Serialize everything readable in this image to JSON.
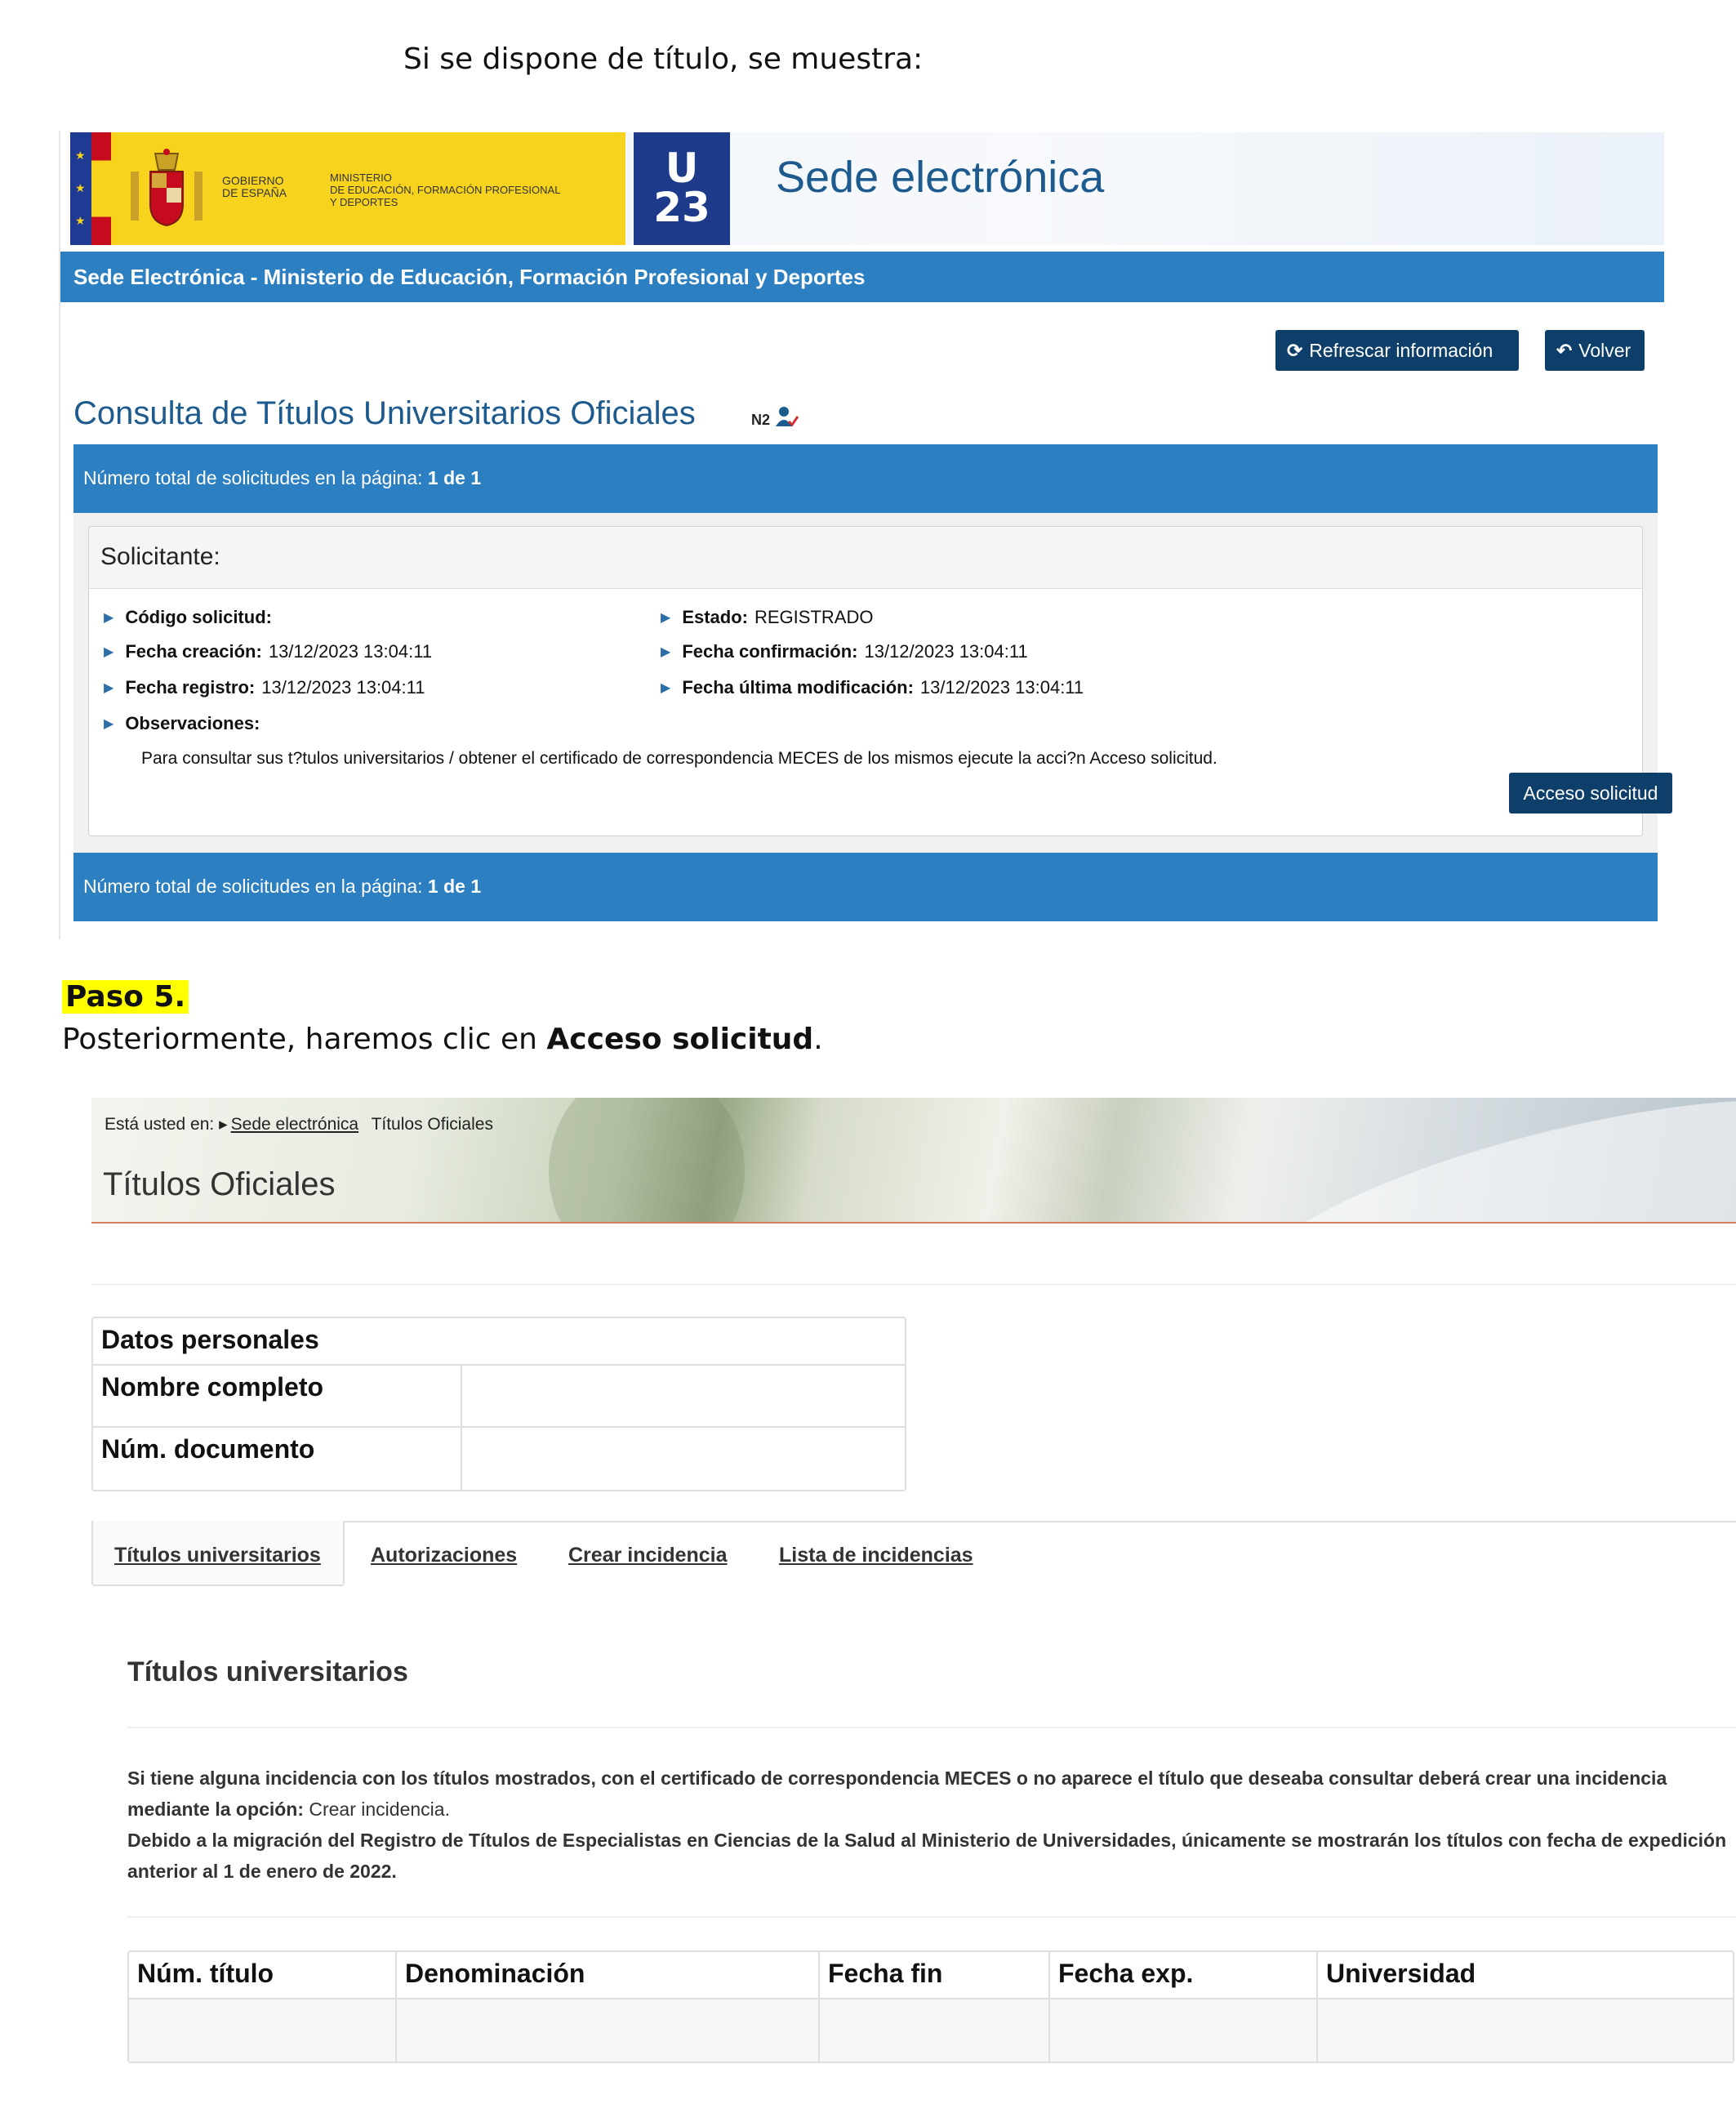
{
  "doc": {
    "intro": "Si se dispone de título, se muestra:",
    "step_label": "Paso 5.",
    "step_text_before": "Posteriormente, haremos clic en ",
    "step_text_bold": "Acceso solicitud",
    "step_text_after": "."
  },
  "sede": {
    "gob_line1": "GOBIERNO",
    "gob_line2": "DE ESPAÑA",
    "min_line1": "MINISTERIO",
    "min_line2": "DE EDUCACIÓN, FORMACIÓN PROFESIONAL",
    "min_line3": "Y DEPORTES",
    "u23_top": "U",
    "u23_bottom": "23",
    "site_title": "Sede electrónica",
    "bar_title": "Sede Electrónica - Ministerio de Educación, Formación Profesional y Deportes",
    "refresh_label": "Refrescar información",
    "volver_label": "Volver",
    "page_title": "Consulta de Títulos Universitarios Oficiales",
    "badge": "N2",
    "count_label": "Número total de solicitudes en la página:",
    "count_value": "1 de 1",
    "panel_title": "Solicitante:",
    "fields": {
      "codigo_label": "Código solicitud:",
      "codigo_value": "",
      "estado_label": "Estado:",
      "estado_value": "REGISTRADO",
      "creacion_label": "Fecha creación:",
      "creacion_value": "13/12/2023 13:04:11",
      "confirmacion_label": "Fecha confirmación:",
      "confirmacion_value": "13/12/2023 13:04:11",
      "registro_label": "Fecha registro:",
      "registro_value": "13/12/2023 13:04:11",
      "modificacion_label": "Fecha última modificación:",
      "modificacion_value": "13/12/2023 13:04:11",
      "observaciones_label": "Observaciones:",
      "observaciones_value": "Para consultar sus t?tulos universitarios / obtener el certificado de correspondencia MECES de los mismos ejecute la acci?n Acceso solicitud."
    },
    "acceso_label": "Acceso solicitud"
  },
  "titulos": {
    "crumb_prefix": "Está usted en:",
    "crumb_link": "Sede electrónica",
    "crumb_current": "Títulos Oficiales",
    "heading": "Títulos Oficiales",
    "personal_header": "Datos personales",
    "nombre_label": "Nombre completo",
    "nombre_value": "",
    "documento_label": "Núm. documento",
    "documento_value": "",
    "tabs": [
      "Títulos universitarios",
      "Autorizaciones",
      "Crear incidencia",
      "Lista de incidencias"
    ],
    "section_heading": "Títulos universitarios",
    "info_line1a": "Si tiene alguna incidencia con los títulos mostrados, con el certificado de correspondencia MECES o no aparece el título que deseaba consultar deberá crear una incidencia mediante la opción:",
    "info_line1b": " Crear incidencia.",
    "info_line2": "Debido a la migración del Registro de Títulos de Especialistas en Ciencias de la Salud al Ministerio de Universidades, únicamente se mostrarán los títulos con fecha de expedición anterior al 1 de enero de 2022.",
    "columns": [
      "Núm. título",
      "Denominación",
      "Fecha fin",
      "Fecha exp.",
      "Universidad"
    ]
  }
}
